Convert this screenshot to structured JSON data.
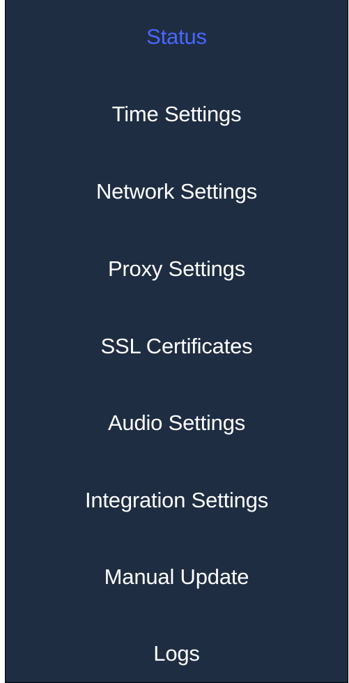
{
  "sidebar": {
    "items": [
      {
        "label": "Status",
        "active": true
      },
      {
        "label": "Time Settings"
      },
      {
        "label": "Network Settings"
      },
      {
        "label": "Proxy Settings"
      },
      {
        "label": "SSL Certificates"
      },
      {
        "label": "Audio Settings"
      },
      {
        "label": "Integration Settings"
      },
      {
        "label": "Manual Update"
      },
      {
        "label": "Logs"
      }
    ]
  },
  "colors": {
    "sidebar_background": "#1e2d42",
    "active_item": "#4a67ff",
    "item_text": "#ffffff"
  }
}
